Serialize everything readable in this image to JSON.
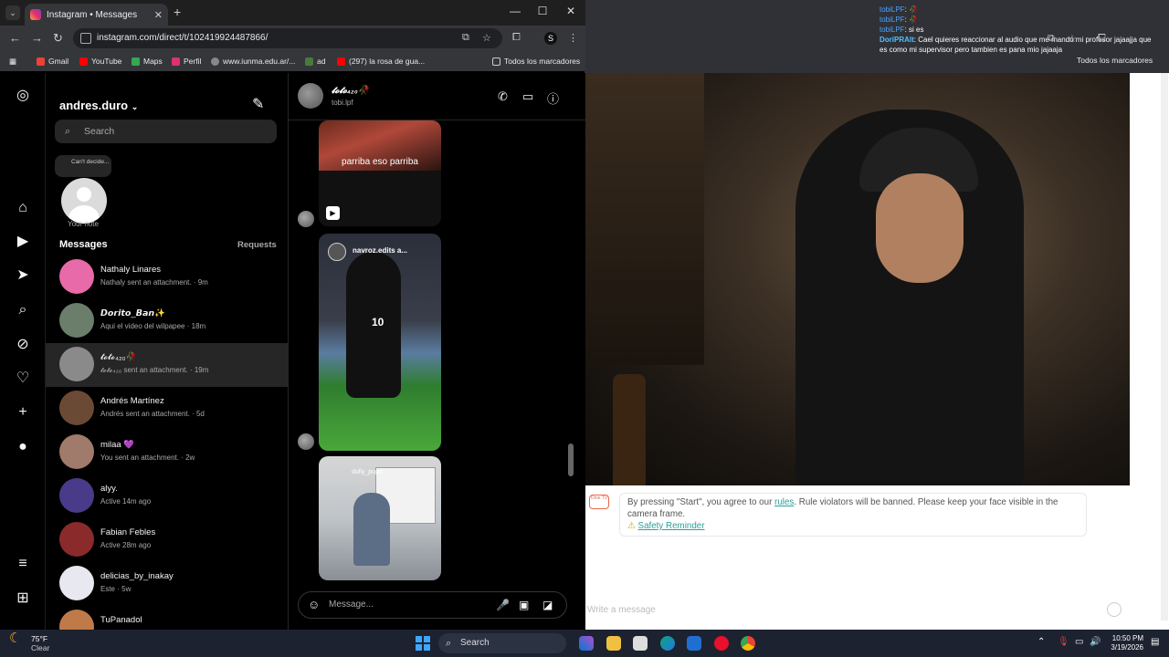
{
  "browser": {
    "tab_title": "Instagram • Messages",
    "url": "instagram.com/direct/t/102419924487866/",
    "bookmarks": [
      "Gmail",
      "YouTube",
      "Maps",
      "Perfil",
      "www.iunma.edu.ar/...",
      "ad",
      "(297) la rosa de gua...",
      "Todos los marcadores"
    ],
    "profile_initial": "S"
  },
  "instagram": {
    "username": "andres.duro",
    "search_placeholder": "Search",
    "note_text": "Can't decide...",
    "note_label": "Your note",
    "messages_heading": "Messages",
    "requests_label": "Requests",
    "threads": [
      {
        "name": "Nathaly Linares",
        "preview": "Nathaly sent an attachment. · 9m",
        "avatar_color": "#e86aa8"
      },
      {
        "name": "𝘿𝙤𝙧𝙞𝙩𝙤_𝘽𝙖𝙣✨",
        "preview": "Aqui el video del wilpapee · 18m",
        "avatar_color": "#6b7d6b"
      },
      {
        "name": "𝓽𝓸𝓽𝓸₄₂₀🥀",
        "preview": "𝓽𝓸𝓽𝓸₄₂₀ sent an attachment. · 19m",
        "avatar_color": "#8a8a8a"
      },
      {
        "name": "Andrés Martínez",
        "preview": "Andrés sent an attachment. · 5d",
        "avatar_color": "#6b4a35"
      },
      {
        "name": "milaa 💜",
        "preview": "You sent an attachment. · 2w",
        "avatar_color": "#a07a6a"
      },
      {
        "name": "alyy.",
        "preview": "Active 14m ago",
        "avatar_color": "#4a3a8a"
      },
      {
        "name": "Fabian Febles",
        "preview": "Active 28m ago",
        "avatar_color": "#8a2a2a"
      },
      {
        "name": "delicias_by_inakay",
        "preview": "Este · 5w",
        "avatar_color": "#e8e8f0"
      },
      {
        "name": "TuPanadol",
        "preview": "",
        "avatar_color": "#c07a4a"
      }
    ],
    "conversation": {
      "name": "𝓽𝓸𝓽𝓸₄₂₀🥀",
      "username": "tobi.lpf",
      "media1_caption": "parriba eso parriba",
      "media2_caption": "navroz.edits a...",
      "media2_number": "10",
      "media3_caption": "dolly_pupa",
      "composer_placeholder": "Message..."
    }
  },
  "stream": {
    "chat": [
      {
        "user": "tobiLPF",
        "msg": ": 🥀"
      },
      {
        "user": "tobiLPF",
        "msg": ": 🥀"
      },
      {
        "user": "tobiLPF",
        "msg": ": si es"
      },
      {
        "user": "DoriPRAlt",
        "msg": ": Cael quieres reaccionar al audio que me mando mi profesor jajaajja que"
      },
      {
        "user": "",
        "msg": "es como mi supervisor pero tambien es pana mio jajaaja"
      }
    ],
    "bookmarks_label": "Todos los marcadores",
    "notice_badge": "Ome TV",
    "notice_pre": "By pressing \"Start\", you agree to our ",
    "notice_link": "rules",
    "notice_post": ". Rule violators will be banned. Please keep your face visible in the camera frame.",
    "safety_reminder": "Safety Reminder",
    "write_placeholder": "Write a message"
  },
  "taskbar": {
    "temp": "75°F",
    "condition": "Clear",
    "search_label": "Search",
    "time": "10:50 PM",
    "date": "3/19/2026"
  }
}
